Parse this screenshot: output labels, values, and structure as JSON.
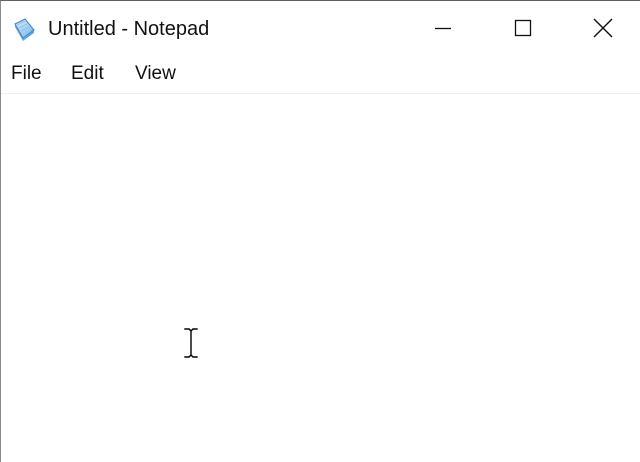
{
  "window": {
    "title": "Untitled - Notepad",
    "app_icon": "notepad-icon"
  },
  "controls": {
    "minimize_icon": "minimize-icon",
    "maximize_icon": "maximize-icon",
    "close_icon": "close-icon"
  },
  "menu": {
    "items": [
      {
        "label": "File"
      },
      {
        "label": "Edit"
      },
      {
        "label": "View"
      }
    ]
  },
  "editor": {
    "content": ""
  },
  "cursor": {
    "icon": "text-cursor-icon"
  }
}
